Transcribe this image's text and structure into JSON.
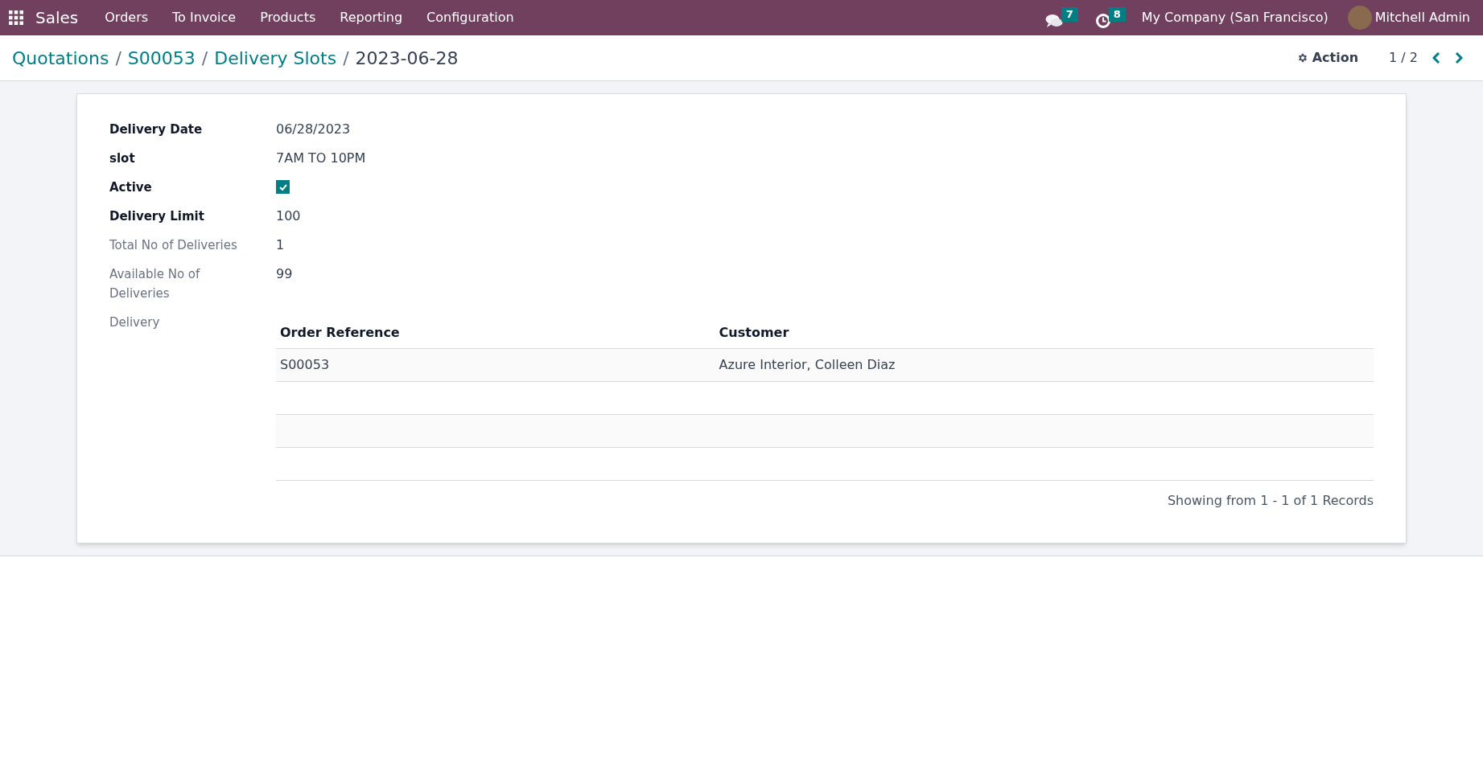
{
  "navbar": {
    "app": "Sales",
    "menu": [
      "Orders",
      "To Invoice",
      "Products",
      "Reporting",
      "Configuration"
    ],
    "messages_count": "7",
    "activities_count": "8",
    "company": "My Company (San Francisco)",
    "user": "Mitchell Admin"
  },
  "breadcrumbs": [
    {
      "label": "Quotations",
      "link": true
    },
    {
      "separator": "/",
      "label": "S00053",
      "link": true
    },
    {
      "separator": "/",
      "label": "Delivery Slots",
      "link": true
    },
    {
      "separator": "/",
      "label": "2023-06-28",
      "link": false
    }
  ],
  "control_panel": {
    "action": "Action",
    "pager": "1 / 2"
  },
  "fields": [
    {
      "kind": "text",
      "label": "Delivery Date",
      "required": true,
      "value": "06/28/2023"
    },
    {
      "kind": "text",
      "label": "slot",
      "required": true,
      "value": "7AM TO 10PM"
    },
    {
      "kind": "checkbox",
      "label": "Active",
      "required": true,
      "checked": true
    },
    {
      "kind": "text",
      "label": "Delivery Limit",
      "required": true,
      "value": "100"
    },
    {
      "kind": "text",
      "label": "Total No of Deliveries",
      "required": false,
      "value": "1"
    },
    {
      "kind": "text",
      "label": "Available No of Deliveries",
      "required": false,
      "value": "99"
    },
    {
      "kind": "table",
      "label": "Delivery",
      "required": false,
      "columns": [
        "Order Reference",
        "Customer"
      ],
      "rows": [
        [
          "S00053",
          "Azure Interior, Colleen Diaz"
        ]
      ],
      "footer": "Showing from 1 - 1 of 1 Records"
    }
  ]
}
